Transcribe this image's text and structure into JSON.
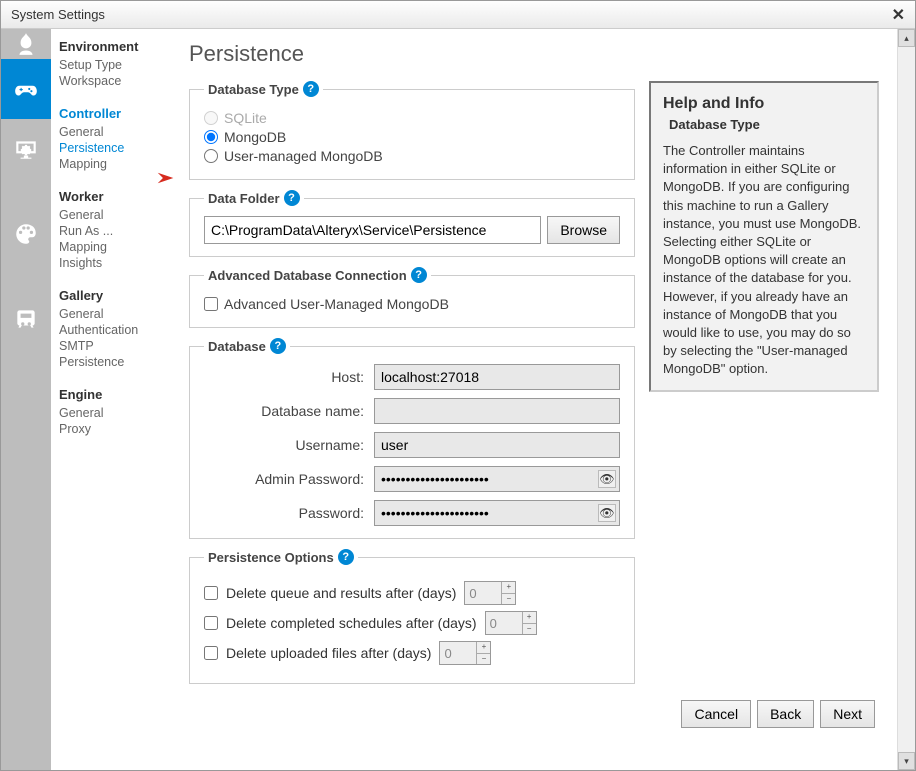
{
  "window": {
    "title": "System Settings"
  },
  "nav": {
    "sections": [
      {
        "title": "Environment",
        "active": false,
        "items": [
          {
            "label": "Setup Type",
            "active": false
          },
          {
            "label": "Workspace",
            "active": false
          }
        ]
      },
      {
        "title": "Controller",
        "active": true,
        "items": [
          {
            "label": "General",
            "active": false
          },
          {
            "label": "Persistence",
            "active": true
          },
          {
            "label": "Mapping",
            "active": false
          }
        ]
      },
      {
        "title": "Worker",
        "active": false,
        "items": [
          {
            "label": "General",
            "active": false
          },
          {
            "label": "Run As ...",
            "active": false
          },
          {
            "label": "Mapping",
            "active": false
          },
          {
            "label": "Insights",
            "active": false
          }
        ]
      },
      {
        "title": "Gallery",
        "active": false,
        "items": [
          {
            "label": "General",
            "active": false
          },
          {
            "label": "Authentication",
            "active": false
          },
          {
            "label": "SMTP",
            "active": false
          },
          {
            "label": "Persistence",
            "active": false
          }
        ]
      },
      {
        "title": "Engine",
        "active": false,
        "items": [
          {
            "label": "General",
            "active": false
          },
          {
            "label": "Proxy",
            "active": false
          }
        ]
      }
    ]
  },
  "page": {
    "title": "Persistence"
  },
  "dbtype": {
    "legend": "Database Type",
    "options": {
      "sqlite": "SQLite",
      "mongodb": "MongoDB",
      "usermanaged": "User-managed MongoDB"
    },
    "selected": "mongodb",
    "sqlite_disabled": true
  },
  "datafolder": {
    "legend": "Data Folder",
    "value": "C:\\ProgramData\\Alteryx\\Service\\Persistence",
    "browse": "Browse"
  },
  "advconn": {
    "legend": "Advanced Database Connection",
    "checkbox": "Advanced User-Managed MongoDB",
    "checked": false
  },
  "database": {
    "legend": "Database",
    "labels": {
      "host": "Host:",
      "dbname": "Database name:",
      "username": "Username:",
      "adminpwd": "Admin Password:",
      "pwd": "Password:"
    },
    "values": {
      "host": "localhost:27018",
      "dbname": "",
      "username": "user",
      "adminpwd": "••••••••••••••••••••••",
      "pwd": "••••••••••••••••••••••"
    }
  },
  "persistopts": {
    "legend": "Persistence Options",
    "opt1": {
      "label": "Delete queue and results after (days)",
      "value": "0",
      "checked": false
    },
    "opt2": {
      "label": "Delete completed schedules after (days)",
      "value": "0",
      "checked": false
    },
    "opt3": {
      "label": "Delete uploaded files after (days)",
      "value": "0",
      "checked": false
    }
  },
  "help": {
    "title": "Help and Info",
    "subtitle": "Database Type",
    "body": "The Controller maintains information in either SQLite or MongoDB. If you are configuring this machine to run a Gallery instance, you must use MongoDB. Selecting either SQLite or MongoDB options will create an instance of the database for you. However, if you already have an instance of MongoDB that you would like to use, you may do so by selecting the \"User-managed MongoDB\" option."
  },
  "footer": {
    "cancel": "Cancel",
    "back": "Back",
    "next": "Next"
  }
}
